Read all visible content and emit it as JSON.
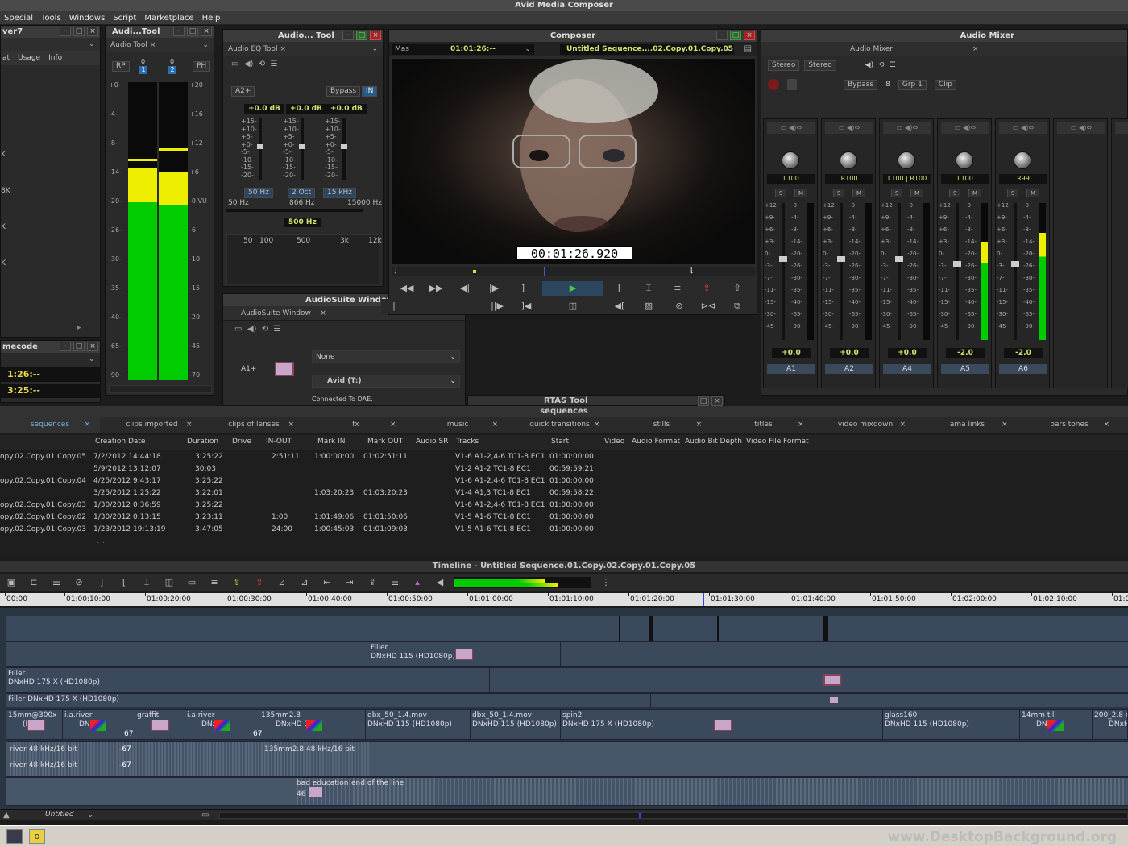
{
  "app": {
    "title": "Avid Media Composer"
  },
  "menu": [
    "Special",
    "Tools",
    "Windows",
    "Script",
    "Marketplace",
    "Help"
  ],
  "left_panel": {
    "title": "ver7",
    "tabs": [
      "at",
      "Usage",
      "Info"
    ],
    "labels": [
      "K",
      "8K",
      "K",
      "K"
    ]
  },
  "timecode_panel": {
    "title": "mecode",
    "tc1": "1:26:--",
    "tc2": "3:25:--"
  },
  "audio_tool": {
    "title": "Audi...Tool",
    "tab": "Audio Tool",
    "btn_rp": "RP",
    "btn_ph": "PH",
    "ch1": "1",
    "ch2": "2",
    "ch_zero": "0",
    "left_scale": [
      "+0-",
      "-4-",
      "-8-",
      "-14-",
      "-20-",
      "-26-",
      "-30-",
      "-35-",
      "-40-",
      "-65-",
      "-90-"
    ],
    "right_scale": [
      "+20",
      "+16",
      "+12",
      "+6",
      "-0 VU",
      "-6",
      "-10",
      "-15",
      "-20",
      "-45",
      "-70"
    ],
    "ch1_level": 0.71,
    "ch2_level": 0.7
  },
  "eq_tool": {
    "title": "Audio... Tool",
    "tab": "Audio EQ Tool",
    "track": "A2+",
    "bypass": "Bypass",
    "in_label": "IN",
    "gains": [
      "+0.0 dB",
      "+0.0 dB",
      "+0.0 dB"
    ],
    "scale": [
      "+15-",
      "+10-",
      "+5-",
      "+0-",
      "-5-",
      "-10-",
      "-15-",
      "-20-"
    ],
    "bands": [
      "50 Hz",
      "2 Oct",
      "15 kHz"
    ],
    "freq_low": "50 Hz",
    "freq_mid": "866 Hz",
    "freq_high": "15000 Hz",
    "center": "500 Hz",
    "graph_ticks": [
      "50",
      "100",
      "500",
      "3k",
      "12k"
    ]
  },
  "audiosuite": {
    "title": "AudioSuite Window",
    "tab": "AudioSuite Window",
    "track": "A1+",
    "plugin": "None",
    "target": "Avid (T:)",
    "status": "Connected To DAE."
  },
  "composer": {
    "title": "Composer",
    "source_name": "Mas",
    "source_tc": "01:01:26:--",
    "sequence": "Untitled Sequence....02.Copy.01.Copy.05",
    "timecode_overlay": "00:01:26.920"
  },
  "rtas": {
    "title": "RTAS Tool"
  },
  "mixer": {
    "title": "Audio Mixer",
    "tab": "Audio Mixer",
    "mode1": "Stereo",
    "mode2": "Stereo",
    "bypass": "Bypass",
    "num": "8",
    "group": "Grp 1",
    "clip": "Clip",
    "channels": [
      {
        "pan": "L100",
        "gain": "+0.0",
        "name": "A1",
        "level": 0
      },
      {
        "pan": "R100",
        "gain": "+0.0",
        "name": "A2",
        "level": 0
      },
      {
        "pan": "L100 | R100",
        "gain": "+0.0",
        "name": "A4",
        "level": 0
      },
      {
        "pan": "L100",
        "gain": "-2.0",
        "name": "A5",
        "level": 0.72
      },
      {
        "pan": "R99",
        "gain": "-2.0",
        "name": "A6",
        "level": 0.78
      }
    ],
    "scale_left": [
      "+12-",
      "+9-",
      "+6-",
      "+3-",
      "0-",
      "-3-",
      "-7-",
      "-11-",
      "-15-",
      "-30-",
      "-45-"
    ],
    "scale_right": [
      "-0-",
      "-4-",
      "-8-",
      "-14-",
      "-20-",
      "-26-",
      "-30-",
      "-35-",
      "-40-",
      "-65-",
      "-90-"
    ],
    "btn_s": "S",
    "btn_m": "M"
  },
  "bin": {
    "title": "sequences",
    "tabs": [
      "sequences",
      "clips imported",
      "clips of lenses",
      "fx",
      "music",
      "quick transitions",
      "stills",
      "titles",
      "video mixdown",
      "ama links",
      "bars tones"
    ],
    "columns": [
      "Creation Date",
      "Duration",
      "Drive",
      "IN-OUT",
      "Mark IN",
      "Mark OUT",
      "Audio SR",
      "Tracks",
      "Start",
      "Video",
      "Audio Format",
      "Audio Bit Depth",
      "Video File Format"
    ],
    "rows": [
      {
        "name": "opy.02.Copy.01.Copy.05",
        "date": "7/2/2012 14:44:18",
        "dur": "3:25:22",
        "inout": "2:51:11",
        "markin": "1:00:00:00",
        "markout": "01:02:51:11",
        "tracks": "V1-6 A1-2,4-6 TC1-8 EC1",
        "start": "01:00:00:00"
      },
      {
        "name": "",
        "date": "5/9/2012 13:12:07",
        "dur": "30:03",
        "inout": "",
        "markin": "",
        "markout": "",
        "tracks": "V1-2 A1-2 TC1-8 EC1",
        "start": "00:59:59:21"
      },
      {
        "name": "opy.02.Copy.01.Copy.04",
        "date": "4/25/2012 9:43:17",
        "dur": "3:25:22",
        "inout": "",
        "markin": "",
        "markout": "",
        "tracks": "V1-6 A1-2,4-6 TC1-8 EC1",
        "start": "01:00:00:00"
      },
      {
        "name": "",
        "date": "3/25/2012 1:25:22",
        "dur": "3:22:01",
        "inout": "",
        "markin": "1:03:20:23",
        "markout": "01:03:20:23",
        "tracks": "V1-4 A1,3 TC1-8 EC1",
        "start": "00:59:58:22"
      },
      {
        "name": "opy.02.Copy.01.Copy.03",
        "date": "1/30/2012 0:36:59",
        "dur": "3:25:22",
        "inout": "",
        "markin": "",
        "markout": "",
        "tracks": "V1-6 A1-2,4-6 TC1-8 EC1",
        "start": "01:00:00:00"
      },
      {
        "name": "opy.02.Copy.01.Copy.02",
        "date": "1/30/2012 0:13:15",
        "dur": "3:23:11",
        "inout": "1:00",
        "markin": "1:01:49:06",
        "markout": "01:01:50:06",
        "tracks": "V1-5 A1-6 TC1-8 EC1",
        "start": "01:00:00:00"
      },
      {
        "name": "opy.02.Copy.01.Copy.03",
        "date": "1/23/2012 19:13:19",
        "dur": "3:47:05",
        "inout": "24:00",
        "markin": "1:00:45:03",
        "markout": "01:01:09:03",
        "tracks": "V1-5 A1-6 TC1-8 EC1",
        "start": "01:00:00:00"
      }
    ]
  },
  "timeline": {
    "title": "Timeline - Untitled Sequence.01.Copy.02.Copy.01.Copy.05",
    "ruler": [
      "00:00",
      "01:00:10:00",
      "01:00:20:00",
      "01:00:30:00",
      "01:00:40:00",
      "01:00:50:00",
      "01:01:00:00",
      "01:01:10:00",
      "01:01:20:00",
      "01:01:30:00",
      "01:01:40:00",
      "01:01:50:00",
      "01:02:00:00",
      "01:02:10:00",
      "01:02"
    ],
    "filler_a": "Filler",
    "filler_a_fmt": "DNxHD 115 (HD1080p)",
    "filler_b": "Filler",
    "filler_b_fmt": "DNxHD 175 X (HD1080p)",
    "filler_c": "Filler DNxHD 175 X (HD1080p)",
    "clips": [
      {
        "name": "15mm@300x",
        "fmt": "(HD"
      },
      {
        "name": "i.a.river",
        "fmt": "DNxH"
      },
      {
        "name": "graffiti",
        "fmt": "DNx"
      },
      {
        "name": "i.a.river",
        "fmt": "DNxHD"
      },
      {
        "name": "135mm2.8",
        "fmt": "DNxHD 115"
      },
      {
        "name": "dbx_50_1.4.mov",
        "fmt": "DNxHD 115 (HD1080p)"
      },
      {
        "name": "dbx_50_1.4.mov",
        "fmt": "DNxHD 115 (HD1080p)"
      },
      {
        "name": "spin2",
        "fmt": "DNxHD 175 X (HD1080p)"
      },
      {
        "name": "glass160",
        "fmt": "DNxHD 115 (HD1080p)"
      },
      {
        "name": "14mm till",
        "fmt": "DNxHD"
      },
      {
        "name": "200_2.8 r",
        "fmt": "DNxHD 11"
      }
    ],
    "audio_a1": "river 48 kHz/16 bit",
    "audio_a1_db": "-67",
    "audio_a2": "river 48 kHz/16 bit",
    "audio_a2_db": "-67",
    "audio_b": "135mm2.8 48 kHz/16 bit",
    "audio_c": "bad education",
    "audio_c2": "end of the line",
    "audio_c_num": "46",
    "small_num1": "67",
    "small_num2": "67",
    "footer_name": "Untitled",
    "meter_level": 0.75
  },
  "watermark": "www.DesktopBackground.org"
}
